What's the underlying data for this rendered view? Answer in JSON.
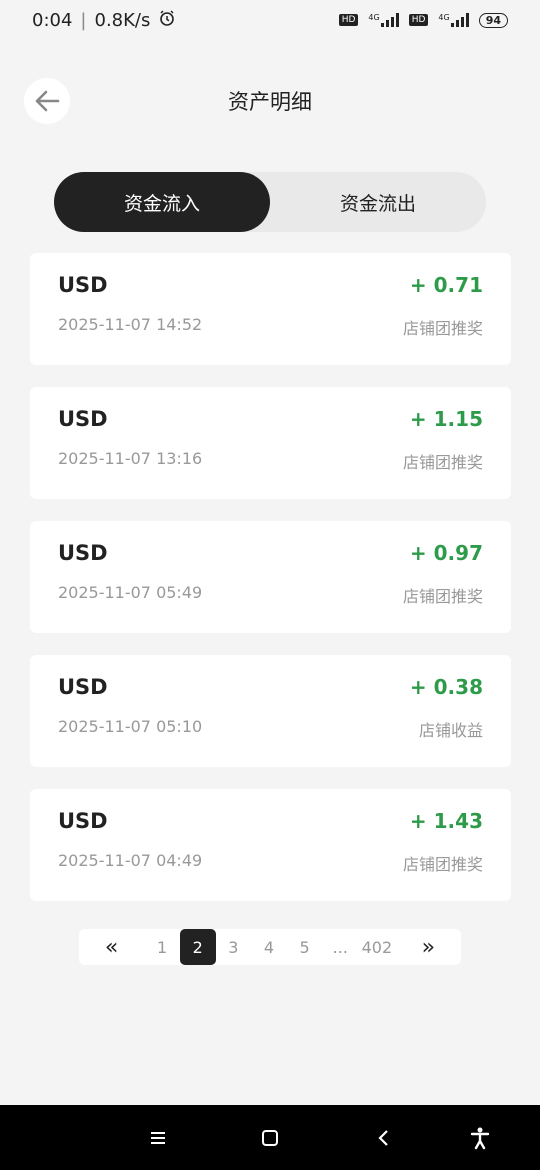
{
  "status_bar": {
    "time": "0:04",
    "speed": "0.8K/s",
    "hd1": "HD",
    "net1": "4G",
    "hd2": "HD",
    "net2": "4G",
    "battery": "94"
  },
  "header": {
    "title": "资产明细"
  },
  "tabs": [
    {
      "label": "资金流入",
      "active": true
    },
    {
      "label": "资金流出",
      "active": false
    }
  ],
  "records": [
    {
      "currency": "USD",
      "amount": "+ 0.71",
      "time": "2025-11-07 14:52",
      "type": "店铺团推奖"
    },
    {
      "currency": "USD",
      "amount": "+ 1.15",
      "time": "2025-11-07 13:16",
      "type": "店铺团推奖"
    },
    {
      "currency": "USD",
      "amount": "+ 0.97",
      "time": "2025-11-07 05:49",
      "type": "店铺团推奖"
    },
    {
      "currency": "USD",
      "amount": "+ 0.38",
      "time": "2025-11-07 05:10",
      "type": "店铺收益"
    },
    {
      "currency": "USD",
      "amount": "+ 1.43",
      "time": "2025-11-07 04:49",
      "type": "店铺团推奖"
    }
  ],
  "pagination": {
    "prev": "«",
    "pages": [
      "1",
      "2",
      "3",
      "4",
      "5",
      "...",
      "402"
    ],
    "current": "2",
    "next": "»"
  },
  "colors": {
    "accent": "#222222",
    "positive": "#2e9b4a",
    "muted": "#999999"
  }
}
